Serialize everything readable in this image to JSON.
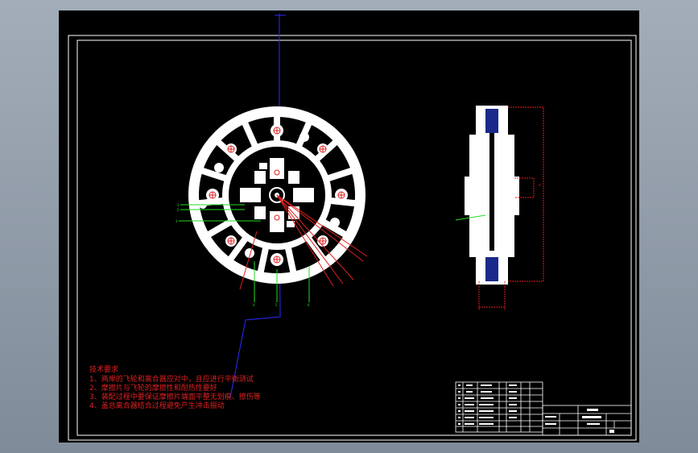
{
  "app": {
    "background_color": "#8f9aa7",
    "canvas_color": "#000000",
    "line_colors": {
      "part": "#ffffff",
      "frame": "#ffffff",
      "dimension": "#e02020",
      "leader": "#22dd22",
      "axis": "#2a2aff"
    }
  },
  "technical_requirements": {
    "title": "技术要求",
    "items": [
      "1、两岸的飞轮和离合器应对中，且应进行平衡测试",
      "2、摩擦片与飞轮的摩擦性和耐热性要好",
      "3、装配过程中要保证摩擦片端面平整无划痕、擦伤等",
      "4、盖总离合器结合过程避免产生冲击振动"
    ]
  }
}
